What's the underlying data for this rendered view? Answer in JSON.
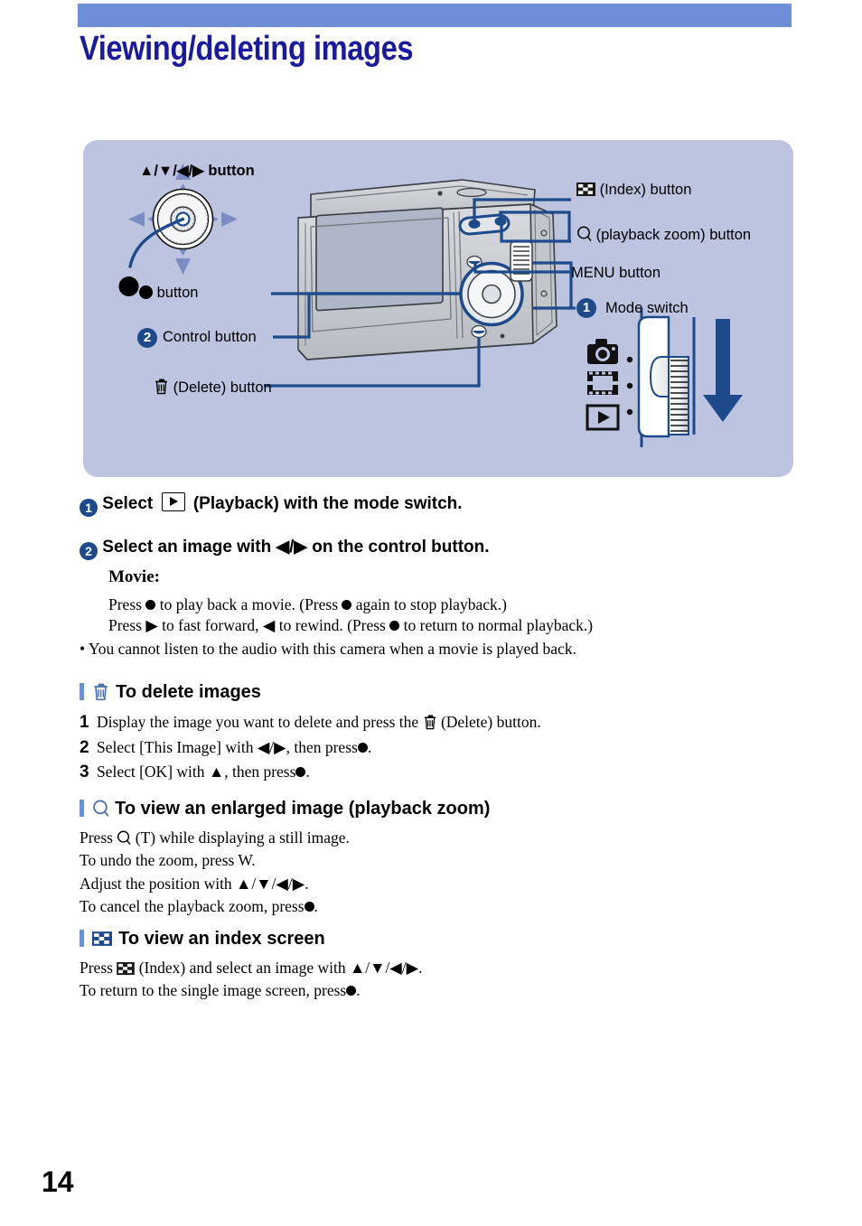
{
  "header": {
    "title": "Viewing/deleting images",
    "bar_color": "#6c8fd8",
    "title_color": "#1a1aa0"
  },
  "diagram": {
    "panel_color": "#bcc4e0",
    "labels": {
      "direction_button": "▲/▼/◀/▶ button",
      "dot_button": "button",
      "control_button": "Control button",
      "control_button_number": "2",
      "delete_button": "(Delete) button",
      "index_button": "(Index) button",
      "playback_zoom_button": "(playback zoom) button",
      "menu_button": "MENU button",
      "mode_switch": "Mode switch",
      "mode_switch_number": "1"
    },
    "icons": {
      "index": "index-checkerboard-icon",
      "zoom": "magnifier-icon",
      "delete": "trash-icon",
      "camera": "still-camera-icon",
      "movie": "movie-film-icon",
      "playback": "playback-triangle-icon",
      "arrow_down": "down-arrow-icon"
    }
  },
  "steps": [
    {
      "number": "1",
      "text_before": "Select",
      "icon": "playback-icon",
      "text_after": "(Playback) with the mode switch."
    },
    {
      "number": "2",
      "text_before": "Select an image with ◀/▶ on the control button.",
      "icon": "",
      "text_after": ""
    }
  ],
  "movie": {
    "heading": "Movie:",
    "line1_a": "Press",
    "line1_b": "to play back a movie. (Press",
    "line1_c": "again to stop playback.)",
    "line2_a": "Press ▶ to fast forward, ◀ to rewind. (Press",
    "line2_b": "to return to normal playback.)",
    "note": "• You cannot listen to the audio with this camera when a movie is played back."
  },
  "sections": [
    {
      "id": "delete-images",
      "icon": "trash-icon",
      "heading": "To delete images",
      "lines": [
        {
          "num": "1",
          "a": "Display the image you want to delete and press the",
          "icon": "trash-icon",
          "b": "(Delete) button."
        },
        {
          "num": "2",
          "a": "Select [This Image] with ◀/▶, then press",
          "icon": "dot-icon",
          "b": "."
        },
        {
          "num": "3",
          "a": "Select [OK] with ▲, then press",
          "icon": "dot-icon",
          "b": "."
        }
      ]
    },
    {
      "id": "enlarged-image",
      "icon": "magnifier-icon",
      "heading": "To view an enlarged image (playback zoom)",
      "lines": [
        {
          "num": "",
          "a": "Press",
          "icon": "magnifier-icon",
          "b": "(T) while displaying a still image."
        },
        {
          "num": "",
          "a": "To undo the zoom, press W.",
          "icon": "",
          "b": ""
        },
        {
          "num": "",
          "a": "Adjust the position with ▲/▼/◀/▶.",
          "icon": "",
          "b": ""
        },
        {
          "num": "",
          "a": "To cancel the playback zoom, press",
          "icon": "dot-icon",
          "b": "."
        }
      ]
    },
    {
      "id": "index-screen",
      "icon": "index-checkerboard-icon",
      "heading": "To view an index screen",
      "lines": [
        {
          "num": "",
          "a": "Press",
          "icon": "index-checkerboard-icon",
          "b": "(Index) and select an image with ▲/▼/◀/▶."
        },
        {
          "num": "",
          "a": "To return to the single image screen, press",
          "icon": "dot-icon",
          "b": "."
        }
      ]
    }
  ],
  "footer": {
    "page_number": "14"
  }
}
